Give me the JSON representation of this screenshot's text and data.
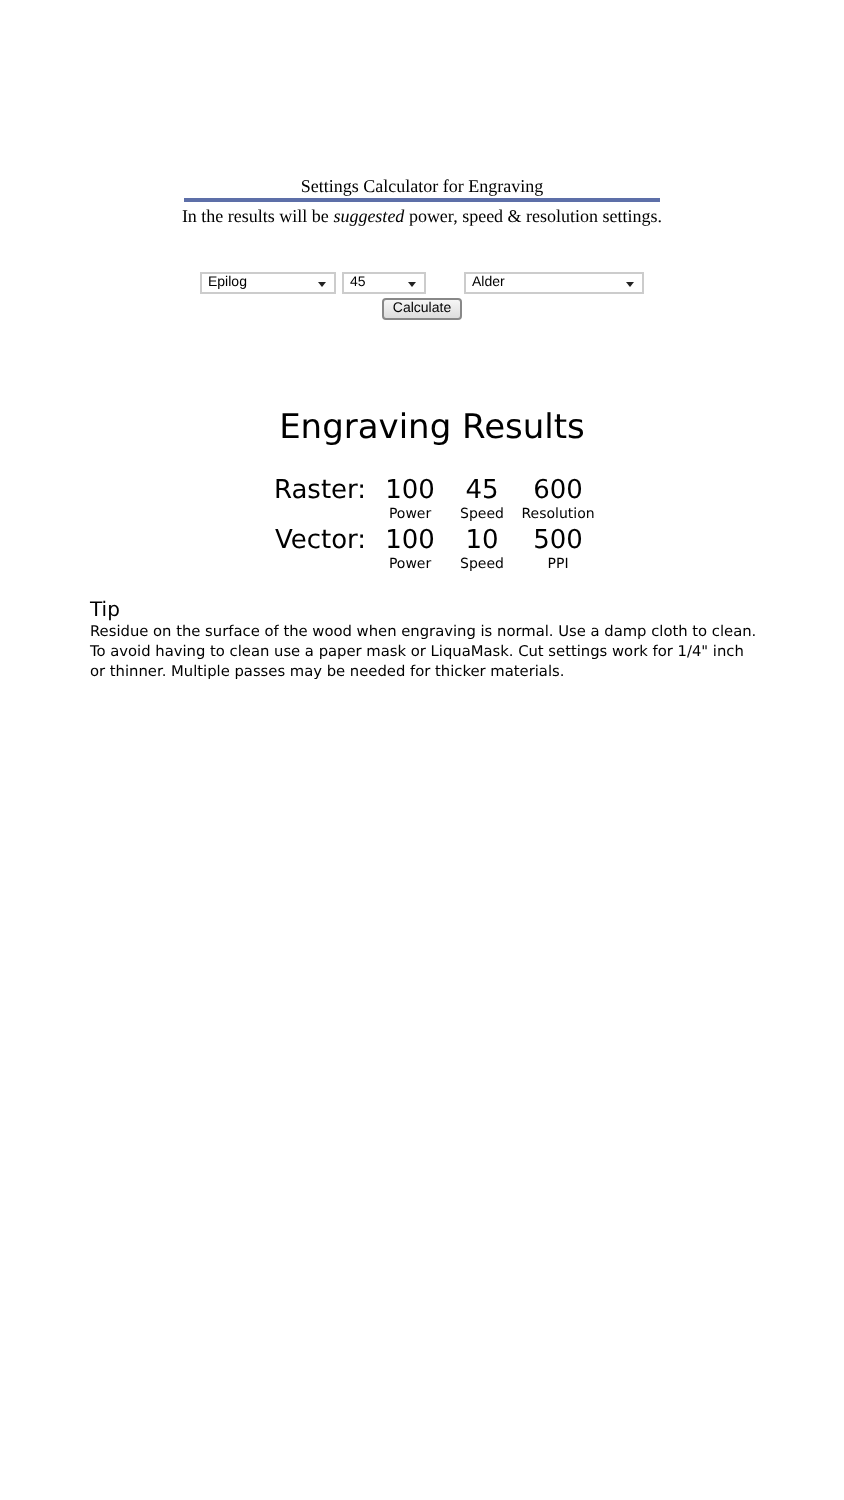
{
  "header": {
    "title": "Settings Calculator for Engraving",
    "subtitle": "In the results will be *suggested* power, speed & resolution settings."
  },
  "form": {
    "selects": [
      {
        "value": "Epilog"
      },
      {
        "value": "45"
      },
      {
        "value": "Alder"
      }
    ],
    "button": "Calculate"
  },
  "results": {
    "title": "Engraving Results",
    "rows": [
      {
        "label": "Raster:",
        "values": [
          {
            "value": "100",
            "caption": "Power"
          },
          {
            "value": "45",
            "caption": "Speed"
          },
          {
            "value": "600",
            "caption": "Resolution"
          }
        ]
      },
      {
        "label": "Vector:",
        "values": [
          {
            "value": "100",
            "caption": "Power"
          },
          {
            "value": "10",
            "caption": "Speed"
          },
          {
            "value": "500",
            "caption": "PPI"
          }
        ]
      }
    ]
  },
  "tip": {
    "heading": "Tip",
    "text": "Residue on the surface of the wood when engraving is normal. Use a damp cloth to clean. To avoid having to clean use a paper mask or LiquaMask. Cut settings work for 1/4\" inch or thinner. Multiple passes may be needed for thicker materials."
  }
}
